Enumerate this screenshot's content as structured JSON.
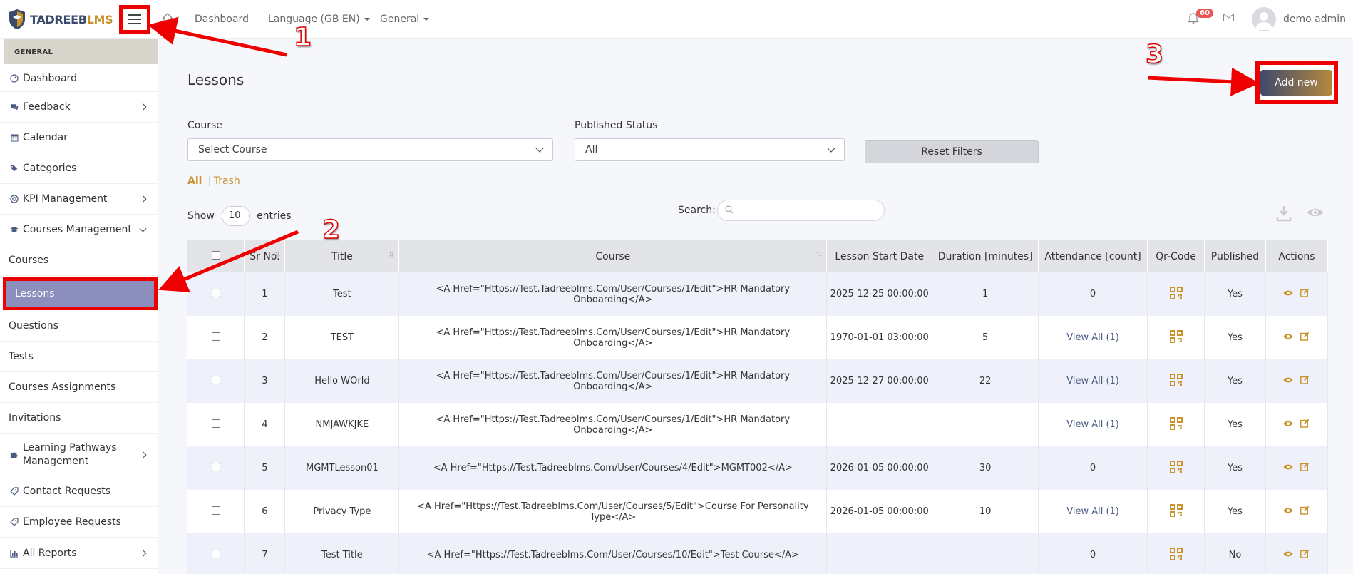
{
  "brand": {
    "part1": "TADREEB",
    "part2": "LMS"
  },
  "topnav": {
    "dashboard": "Dashboard",
    "language": "Language (GB EN)",
    "general": "General"
  },
  "notifications": {
    "count": "60"
  },
  "user": {
    "name": "demo admin"
  },
  "sidebar": {
    "section": "GENERAL",
    "items": [
      {
        "label": "Dashboard",
        "icon": "gauge-icon"
      },
      {
        "label": "Feedback",
        "icon": "comments-icon"
      },
      {
        "label": "Calendar",
        "icon": "calendar-icon"
      },
      {
        "label": "Categories",
        "icon": "tags-icon"
      },
      {
        "label": "KPI Management",
        "icon": "target-icon"
      },
      {
        "label": "Courses Management",
        "icon": "graduation-cap-icon"
      },
      {
        "label": "Courses"
      },
      {
        "label": "Lessons"
      },
      {
        "label": "Questions"
      },
      {
        "label": "Tests"
      },
      {
        "label": "Courses Assignments"
      },
      {
        "label": "Invitations"
      },
      {
        "label": "Learning Pathways Management",
        "icon": "puzzle-icon"
      },
      {
        "label": "Contact Requests",
        "icon": "tag-icon"
      },
      {
        "label": "Employee Requests",
        "icon": "tag-icon"
      },
      {
        "label": "All Reports",
        "icon": "bar-chart-icon"
      }
    ]
  },
  "page": {
    "title": "Lessons",
    "add_new": "Add new"
  },
  "filters": {
    "course_label": "Course",
    "course_value": "Select Course",
    "status_label": "Published Status",
    "status_value": "All",
    "reset": "Reset Filters",
    "tab_all": "All",
    "tab_trash": "Trash"
  },
  "table_controls": {
    "show": "Show",
    "entries_value": "10",
    "entries": "entries",
    "search": "Search:"
  },
  "table": {
    "headers": [
      "Sr No.",
      "Title",
      "Course",
      "Lesson Start Date",
      "Duration [minutes]",
      "Attendance [count]",
      "Qr-Code",
      "Published",
      "Actions"
    ],
    "rows": [
      {
        "sr": "1",
        "title": "Test",
        "course": "<A Href=\"Https://Test.Tadreeblms.Com/User/Courses/1/Edit\">HR Mandatory Onboarding</A>",
        "start": "2025-12-25 00:00:00",
        "duration": "1",
        "attendance": "0",
        "attendance_link": false,
        "published": "Yes"
      },
      {
        "sr": "2",
        "title": "TEST",
        "course": "<A Href=\"Https://Test.Tadreeblms.Com/User/Courses/1/Edit\">HR Mandatory Onboarding</A>",
        "start": "1970-01-01 03:00:00",
        "duration": "5",
        "attendance": "View All (1)",
        "attendance_link": true,
        "published": "Yes"
      },
      {
        "sr": "3",
        "title": "Hello WOrld",
        "course": "<A Href=\"Https://Test.Tadreeblms.Com/User/Courses/1/Edit\">HR Mandatory Onboarding</A>",
        "start": "2025-12-27 00:00:00",
        "duration": "22",
        "attendance": "View All (1)",
        "attendance_link": true,
        "published": "Yes"
      },
      {
        "sr": "4",
        "title": "NMJAWKJKE",
        "course": "<A Href=\"Https://Test.Tadreeblms.Com/User/Courses/1/Edit\">HR Mandatory Onboarding</A>",
        "start": "",
        "duration": "",
        "attendance": "View All (1)",
        "attendance_link": true,
        "published": "Yes"
      },
      {
        "sr": "5",
        "title": "MGMTLesson01",
        "course": "<A Href=\"Https://Test.Tadreeblms.Com/User/Courses/4/Edit\">MGMT002</A>",
        "start": "2026-01-05 00:00:00",
        "duration": "30",
        "attendance": "0",
        "attendance_link": false,
        "published": "Yes"
      },
      {
        "sr": "6",
        "title": "Privacy Type",
        "course": "<A Href=\"Https://Test.Tadreeblms.Com/User/Courses/5/Edit\">Course For Personality Type</A>",
        "start": "2026-01-05 00:00:00",
        "duration": "10",
        "attendance": "View All (1)",
        "attendance_link": true,
        "published": "Yes"
      },
      {
        "sr": "7",
        "title": "Test Title",
        "course": "<A Href=\"Https://Test.Tadreeblms.Com/User/Courses/10/Edit\">Test Course</A>",
        "start": "",
        "duration": "",
        "attendance": "0",
        "attendance_link": false,
        "published": "No"
      }
    ]
  },
  "annotations": {
    "step1": "1",
    "step2": "2",
    "step3": "3"
  },
  "colors": {
    "accent": "#c9922c",
    "annotation": "#ef0000",
    "sidebar_active": "#8c8fbd",
    "navy": "#3f4a6c"
  }
}
